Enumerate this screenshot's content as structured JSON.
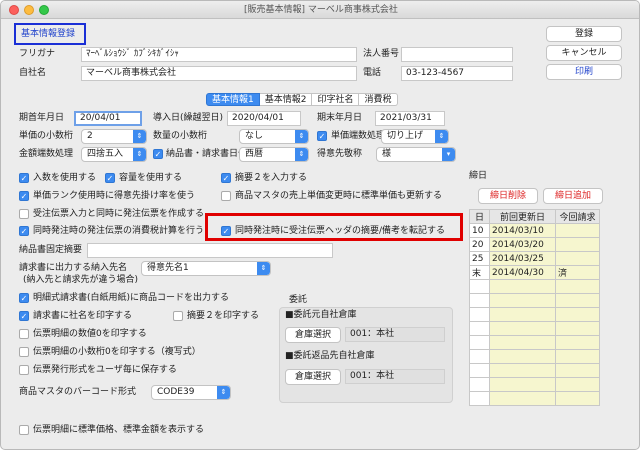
{
  "window": {
    "title": "[販売基本情報] マーベル商事株式会社"
  },
  "header": {
    "section_label": "基本情報登録",
    "furigana_label": "フリガナ",
    "furigana_value": "ﾏｰﾍﾞﾙｼｮｳｼﾞ ｶﾌﾞｼｷｶﾞｲｼｬ",
    "company_label": "自社名",
    "company_value": "マーベル商事株式会社",
    "corp_no_label": "法人番号",
    "corp_no_value": "",
    "phone_label": "電話",
    "phone_value": "03-123-4567"
  },
  "actions": {
    "register": "登録",
    "cancel": "キャンセル",
    "print": "印刷"
  },
  "tabs": [
    {
      "label": "基本情報1",
      "active": true
    },
    {
      "label": "基本情報2",
      "active": false
    },
    {
      "label": "印字社名",
      "active": false
    },
    {
      "label": "消費税",
      "active": false
    }
  ],
  "dates": {
    "fy_start_label": "期首年月日",
    "fy_start_value": "20/04/01",
    "intro_label": "導入日(繰越翌日)",
    "intro_value": "2020/04/01",
    "fy_end_label": "期末年月日",
    "fy_end_value": "2021/03/31"
  },
  "settings": {
    "unit_decimal_label": "単価の小数桁",
    "unit_decimal_value": "2",
    "qty_decimal_label": "数量の小数桁",
    "qty_decimal_value": "なし",
    "unit_rounding_label": "単価端数処理",
    "unit_rounding_value": "切り上げ",
    "amount_rounding_label": "金額端数処理",
    "amount_rounding_value": "四捨五入",
    "invoice_date_label": "納品書・請求書日付",
    "invoice_date_value": "西暦",
    "honorific_label": "得意先敬称",
    "honorific_value": "様"
  },
  "options": {
    "lot_entry": "入数を使用する",
    "capacity": "容量を使用する",
    "summary2": "摘要２を入力する",
    "rank_rate": "単価ランク使用時に得意先掛け率を使う",
    "update_std_price": "商品マスタの売上単価変更時に標準単価も更新する",
    "create_po": "受注伝票入力と同時に発注伝票を作成する",
    "copy_tax": "同時発注時の発注伝票の消費税計算を行う",
    "copy_memo": "同時発注時に受注伝票ヘッダの摘要/備考を転記する",
    "delivery_fixed_label": "納品書固定摘要",
    "billing_dest_label": "請求書に出力する納入先名",
    "billing_dest_note": "(納入先と請求先が違う場合)",
    "billing_dest_value": "得意先名1",
    "print_code": "明細式請求書(白紙用紙)に商品コードを出力する",
    "print_company": "請求書に社名を印字する",
    "print_summary2": "摘要２を印字する",
    "print_zero_qty": "伝票明細の数値0を印字する",
    "print_decimal_zero": "伝票明細の小数桁0を印字する（複写式）",
    "save_format": "伝票発行形式をユーザ毎に保存する",
    "barcode_label": "商品マスタのバーコード形式",
    "barcode_value": "CODE39",
    "show_std_price": "伝票明細に標準価格、標準金額を表示する"
  },
  "consignment": {
    "title": "委託",
    "origin_label": "■委託元自社倉庫",
    "origin_button": "倉庫選択",
    "origin_value": "001：本社",
    "return_label": "■委託返品先自社倉庫",
    "return_button": "倉庫選択",
    "return_value": "001：本社"
  },
  "closing": {
    "title": "締日",
    "delete_button": "締日削除",
    "add_button": "締日追加",
    "columns": [
      "日",
      "前回更新日",
      "今回請求"
    ],
    "rows": [
      {
        "day": "10",
        "last": "2014/03/10",
        "current": ""
      },
      {
        "day": "20",
        "last": "2014/03/20",
        "current": ""
      },
      {
        "day": "25",
        "last": "2014/03/25",
        "current": ""
      },
      {
        "day": "末",
        "last": "2014/04/30",
        "current": "済"
      }
    ]
  }
}
